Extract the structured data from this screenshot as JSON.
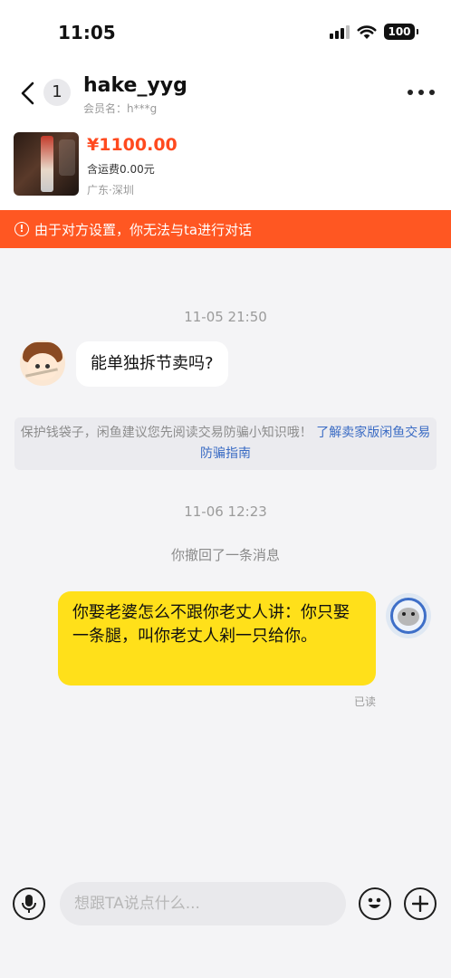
{
  "status_bar": {
    "time": "11:05",
    "battery": "100"
  },
  "header": {
    "badge_count": "1",
    "chat_name": "hake_yyg",
    "member_name": "会员名：h***g"
  },
  "product": {
    "price": "¥1100.00",
    "shipping": "含运费0.00元",
    "location": "广东·深圳"
  },
  "warning_banner": {
    "text": "由于对方设置，你无法与ta进行对话",
    "color": "#ff5722"
  },
  "messages": {
    "time1": "11-05 21:50",
    "left_text": "能单独拆节卖吗?",
    "tip_text": "保护钱袋子，闲鱼建议您先阅读交易防骗小知识哦！",
    "tip_link": "了解卖家版闲鱼交易防骗指南",
    "time2": "11-06 12:23",
    "recall_text": "你撤回了一条消息",
    "right_text": "你娶老婆怎么不跟你老丈人讲：你只娶一条腿，叫你老丈人剁一只给你。",
    "read_status": "已读"
  },
  "input_bar": {
    "placeholder": "想跟TA说点什么..."
  },
  "colors": {
    "accent": "#ff4a1f",
    "bubble_self": "#ffe01a",
    "link": "#3b6cc4"
  }
}
